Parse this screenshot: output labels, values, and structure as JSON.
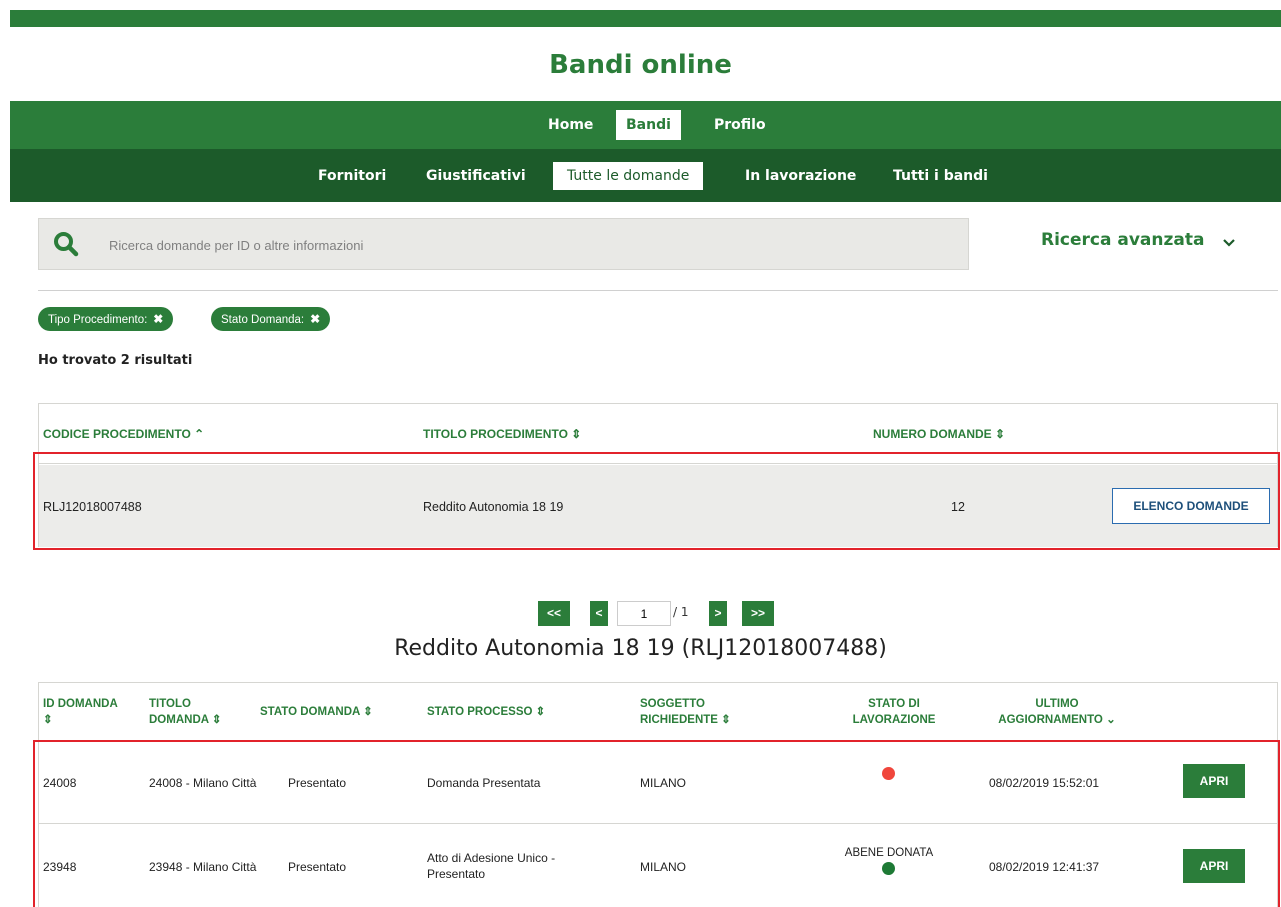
{
  "header": {
    "site_title": "Bandi online"
  },
  "nav_main": {
    "items": [
      {
        "label": "Home"
      },
      {
        "label": "Bandi"
      },
      {
        "label": "Profilo"
      }
    ]
  },
  "nav_sub": {
    "items": [
      {
        "label": "Fornitori"
      },
      {
        "label": "Giustificativi"
      },
      {
        "label": "Tutte le domande"
      },
      {
        "label": "In lavorazione"
      },
      {
        "label": "Tutti i bandi"
      }
    ]
  },
  "search": {
    "placeholder": "Ricerca domande per ID o altre informazioni",
    "value": ""
  },
  "advanced_search": {
    "label": "Ricerca avanzata"
  },
  "filters": [
    {
      "label": "Tipo Procedimento:"
    },
    {
      "label": "Stato Domanda:"
    }
  ],
  "results": {
    "text": "Ho trovato 2 risultati"
  },
  "procedures_table": {
    "columns": [
      "CODICE PROCEDIMENTO",
      "TITOLO PROCEDIMENTO",
      "NUMERO DOMANDE"
    ],
    "rows": [
      {
        "codice": "RLJ12018007488",
        "titolo": "Reddito Autonomia 18 19",
        "numero": "12",
        "action": "ELENCO DOMANDE"
      }
    ]
  },
  "pagination": {
    "first": "<<",
    "prev": "<",
    "current": "1",
    "total": "/ 1",
    "next": ">",
    "last": ">>"
  },
  "detail": {
    "title": "Reddito Autonomia 18 19 (RLJ12018007488)",
    "columns": {
      "id": "ID DOMANDA",
      "titolo": "TITOLO DOMANDA",
      "stato_domanda": "STATO DOMANDA",
      "stato_processo": "STATO PROCESSO",
      "soggetto": "SOGGETTO RICHIEDENTE",
      "stato_lavorazione": "STATO DI LAVORAZIONE",
      "ultimo": "ULTIMO AGGIORNAMENTO"
    },
    "rows": [
      {
        "id": "24008",
        "titolo": "24008 - Milano Città",
        "stato_domanda": "Presentato",
        "stato_processo": "Domanda Presentata",
        "soggetto": "MILANO",
        "lavorazione_label": "",
        "lavorazione_color": "#f0463c",
        "ultimo": "08/02/2019 15:52:01",
        "action": "APRI"
      },
      {
        "id": "23948",
        "titolo": "23948 - Milano Città",
        "stato_domanda": "Presentato",
        "stato_processo": "Atto di Adesione Unico - Presentato",
        "soggetto": "MILANO",
        "lavorazione_label": "ABENE DONATA",
        "lavorazione_color": "#1e7a35",
        "ultimo": "08/02/2019 12:41:37",
        "action": "APRI"
      }
    ]
  },
  "colors": {
    "primary_green": "#2b7d3a",
    "dark_green": "#1c5b2a",
    "highlight_red": "#e2232b"
  }
}
